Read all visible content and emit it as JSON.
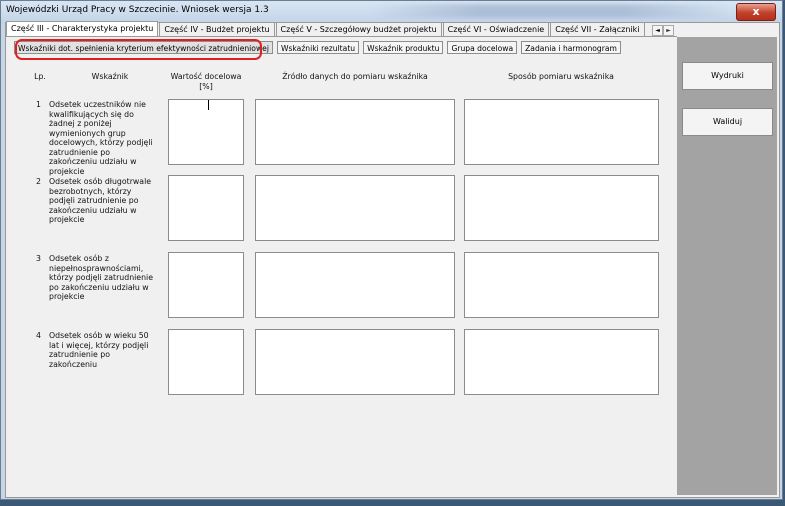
{
  "window": {
    "title": "Wojewódzki Urząd Pracy w Szczecinie. Wniosek wersja 1.3",
    "close_label": "x"
  },
  "tabs": [
    {
      "label": "Część III - Charakterystyka projektu"
    },
    {
      "label": "Część IV - Budżet projektu"
    },
    {
      "label": "Część V - Szczegółowy budżet projektu"
    },
    {
      "label": "Część VI - Oświadczenie"
    },
    {
      "label": "Część VII - Załączniki"
    }
  ],
  "tab_scroll": {
    "left": "◄",
    "right": "►"
  },
  "subtabs": [
    {
      "label": "Wskaźniki dot. spełnienia kryterium efektywności zatrudnieniowej"
    },
    {
      "label": "Wskaźniki rezultatu"
    },
    {
      "label": "Wskaźnik produktu"
    },
    {
      "label": "Grupa docelowa"
    },
    {
      "label": "Zadania i harmonogram"
    }
  ],
  "table": {
    "headers": {
      "lp": "Lp.",
      "indicator": "Wskaźnik",
      "target_value": "Wartość docelowa [%]",
      "data_source": "Źródło danych do pomiaru wskaźnika",
      "method": "Sposób pomiaru wskaźnika"
    },
    "rows": [
      {
        "num": "1",
        "desc": "Odsetek uczestników nie kwalifikujących się do żadnej z poniżej wymienionych grup docelowych, którzy podjęli zatrudnienie po zakończeniu udziału w projekcie"
      },
      {
        "num": "2",
        "desc": "Odsetek osób długotrwale bezrobotnych, którzy podjęli zatrudnienie po zakończeniu udziału w projekcie"
      },
      {
        "num": "3",
        "desc": "Odsetek osób z niepełnosprawnościami, którzy podjęli zatrudnienie po zakończeniu udziału w projekcie"
      },
      {
        "num": "4",
        "desc": "Odsetek osób w wieku 50 lat i więcej, którzy podjęli zatrudnienie po zakończeniu"
      }
    ]
  },
  "buttons": {
    "print": "Wydruki",
    "validate": "Waliduj"
  }
}
